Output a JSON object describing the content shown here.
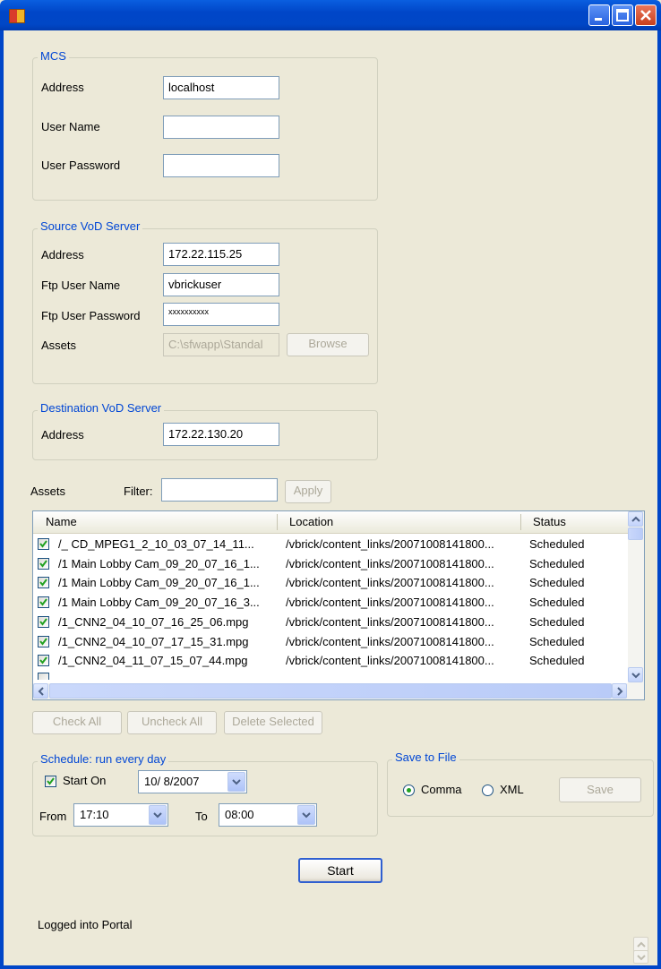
{
  "mcs": {
    "legend": "MCS",
    "address_label": "Address",
    "address_value": "localhost",
    "username_label": "User Name",
    "username_value": "",
    "password_label": "User Password",
    "password_value": ""
  },
  "source": {
    "legend": "Source VoD Server",
    "address_label": "Address",
    "address_value": "172.22.115.25",
    "ftp_user_label": "Ftp User Name",
    "ftp_user_value": "vbrickuser",
    "ftp_password_label": "Ftp User Password",
    "ftp_password_value": "xxxxxxxxxx",
    "assets_label": "Assets",
    "assets_value": "C:\\sfwapp\\Standal",
    "browse_label": "Browse"
  },
  "destination": {
    "legend": "Destination VoD Server",
    "address_label": "Address",
    "address_value": "172.22.130.20"
  },
  "assets": {
    "label": "Assets",
    "filter_label": "Filter:",
    "filter_value": "",
    "apply_label": "Apply",
    "columns": [
      "Name",
      "Location",
      "Status"
    ],
    "rows": [
      {
        "name": "/_ CD_MPEG1_2_10_03_07_14_11...",
        "location": "/vbrick/content_links/20071008141800...",
        "status": "Scheduled",
        "checked": true
      },
      {
        "name": "/1 Main Lobby Cam_09_20_07_16_1...",
        "location": "/vbrick/content_links/20071008141800...",
        "status": "Scheduled",
        "checked": true
      },
      {
        "name": "/1 Main Lobby Cam_09_20_07_16_1...",
        "location": "/vbrick/content_links/20071008141800...",
        "status": "Scheduled",
        "checked": true
      },
      {
        "name": "/1 Main Lobby Cam_09_20_07_16_3...",
        "location": "/vbrick/content_links/20071008141800...",
        "status": "Scheduled",
        "checked": true
      },
      {
        "name": "/1_CNN2_04_10_07_16_25_06.mpg",
        "location": "/vbrick/content_links/20071008141800...",
        "status": "Scheduled",
        "checked": true
      },
      {
        "name": "/1_CNN2_04_10_07_17_15_31.mpg",
        "location": "/vbrick/content_links/20071008141800...",
        "status": "Scheduled",
        "checked": true
      },
      {
        "name": "/1_CNN2_04_11_07_15_07_44.mpg",
        "location": "/vbrick/content_links/20071008141800...",
        "status": "Scheduled",
        "checked": true
      }
    ],
    "check_all_label": "Check All",
    "uncheck_all_label": "Uncheck All",
    "delete_selected_label": "Delete Selected"
  },
  "schedule": {
    "legend": "Schedule: run every day",
    "start_on_label": "Start On",
    "start_on_checked": true,
    "date_value": "10/ 8/2007",
    "from_label": "From",
    "from_value": "17:10",
    "to_label": "To",
    "to_value": "08:00"
  },
  "save_to_file": {
    "legend": "Save to File",
    "comma_label": "Comma",
    "xml_label": "XML",
    "selected": "Comma",
    "save_label": "Save"
  },
  "start_label": "Start",
  "status_text": "Logged into Portal",
  "colors": {
    "title_bar": "#0046c8",
    "window_bg": "#ece9d8",
    "group_legend": "#0046d5"
  }
}
